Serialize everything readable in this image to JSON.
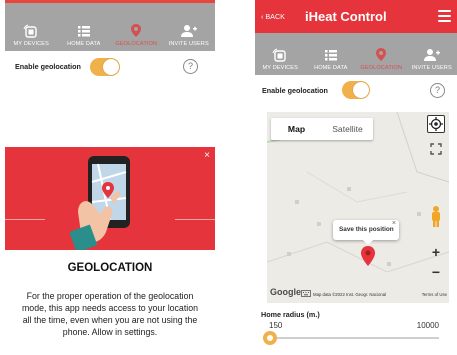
{
  "left_screen": {
    "nav": [
      {
        "label": "MY DEVICES",
        "icon": "devices-icon"
      },
      {
        "label": "HOME DATA",
        "icon": "list-icon"
      },
      {
        "label": "GEOLOCATION",
        "icon": "location-pin-icon",
        "active": true
      },
      {
        "label": "INVITE USERS",
        "icon": "add-user-icon"
      }
    ],
    "geolocation": {
      "label": "Enable geolocation",
      "enabled": true,
      "help": "?"
    },
    "modal": {
      "close": "×",
      "title": "GEOLOCATION",
      "text": "For the proper operation of the geolocation mode, this app needs access to your location all the time, even when you are not using the phone. Allow in settings."
    }
  },
  "right_screen": {
    "header": {
      "back": "BACK",
      "title": "iHeat Control",
      "menu_icon": "hamburger-icon"
    },
    "nav": [
      {
        "label": "MY DEVICES",
        "icon": "devices-icon"
      },
      {
        "label": "HOME DATA",
        "icon": "list-icon"
      },
      {
        "label": "GEOLOCATION",
        "icon": "location-pin-icon",
        "active": true
      },
      {
        "label": "INVITE USERS",
        "icon": "add-user-icon"
      }
    ],
    "geolocation": {
      "label": "Enable geolocation",
      "enabled": true,
      "help": "?"
    },
    "map": {
      "type_map": "Map",
      "type_satellite": "Satellite",
      "popup": "Save this position",
      "popup_close": "×",
      "zoom_in": "+",
      "zoom_out": "−",
      "google": "Google",
      "attribution": "Map data ©2022 Inst. Geogr. Nacional",
      "terms": "Terms of Use"
    },
    "radius": {
      "label": "Home radius (m.)",
      "min": "150",
      "max": "10000",
      "value": 150
    }
  },
  "colors": {
    "brand_red": "#e6343c",
    "nav_gray": "#a4a4a4",
    "toggle_orange": "#f0b04a",
    "active_nav": "#d55050"
  }
}
